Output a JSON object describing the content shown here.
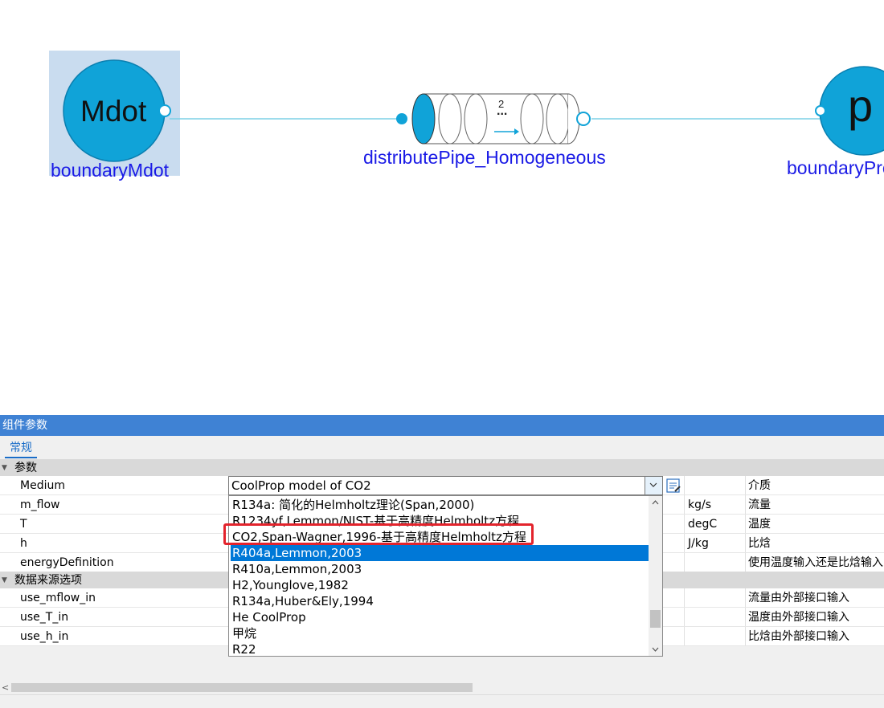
{
  "diagram": {
    "components": [
      {
        "id": "boundaryMdot",
        "label": "boundaryMdot",
        "icon_text": "Mdot"
      },
      {
        "id": "pipe",
        "label": "distributePipe_Homogeneous",
        "icon_text": "2",
        "icon_subtext": "..."
      },
      {
        "id": "boundaryPressure",
        "label": "boundaryPre",
        "icon_text": "p"
      }
    ],
    "colors": {
      "node_fill": "#10a3d8",
      "node_stroke": "#0a7fb0",
      "connection": "#7dd0e6",
      "selection": "#c9dcef",
      "label": "#1a1ae6"
    }
  },
  "panel": {
    "title": "组件参数",
    "tab": "常规",
    "categories": [
      {
        "label": "参数"
      },
      {
        "label": "数据来源选项"
      }
    ],
    "rows": [
      {
        "name": "Medium",
        "value": "CoolProp model of CO2",
        "unit": "",
        "desc": "介质"
      },
      {
        "name": "m_flow",
        "value": "",
        "unit": "kg/s",
        "desc": "流量"
      },
      {
        "name": "T",
        "value": "",
        "unit": "degC",
        "desc": "温度"
      },
      {
        "name": "h",
        "value": "",
        "unit": "J/kg",
        "desc": "比焓"
      },
      {
        "name": "energyDefinition",
        "value": "",
        "unit": "",
        "desc": "使用温度输入还是比焓输入"
      },
      {
        "name": "use_mflow_in",
        "value": "",
        "unit": "",
        "desc": "流量由外部接口输入"
      },
      {
        "name": "use_T_in",
        "value": "",
        "unit": "",
        "desc": "温度由外部接口输入"
      },
      {
        "name": "use_h_in",
        "value": "",
        "unit": "",
        "desc": "比焓由外部接口输入"
      }
    ],
    "dropdown_items": [
      "R134a: 简化的Helmholtz理论(Span,2000)",
      "R1234yf,Lemmon/NIST-基于高精度Helmholtz方程",
      "CO2,Span-Wagner,1996-基于高精度Helmholtz方程",
      "R404a,Lemmon,2003",
      "R410a,Lemmon,2003",
      "H2,Younglove,1982",
      "R134a,Huber&Ely,1994",
      "He CoolProp",
      "甲烷",
      "R22"
    ],
    "selected_index": 3,
    "highlighted_index": 2
  }
}
